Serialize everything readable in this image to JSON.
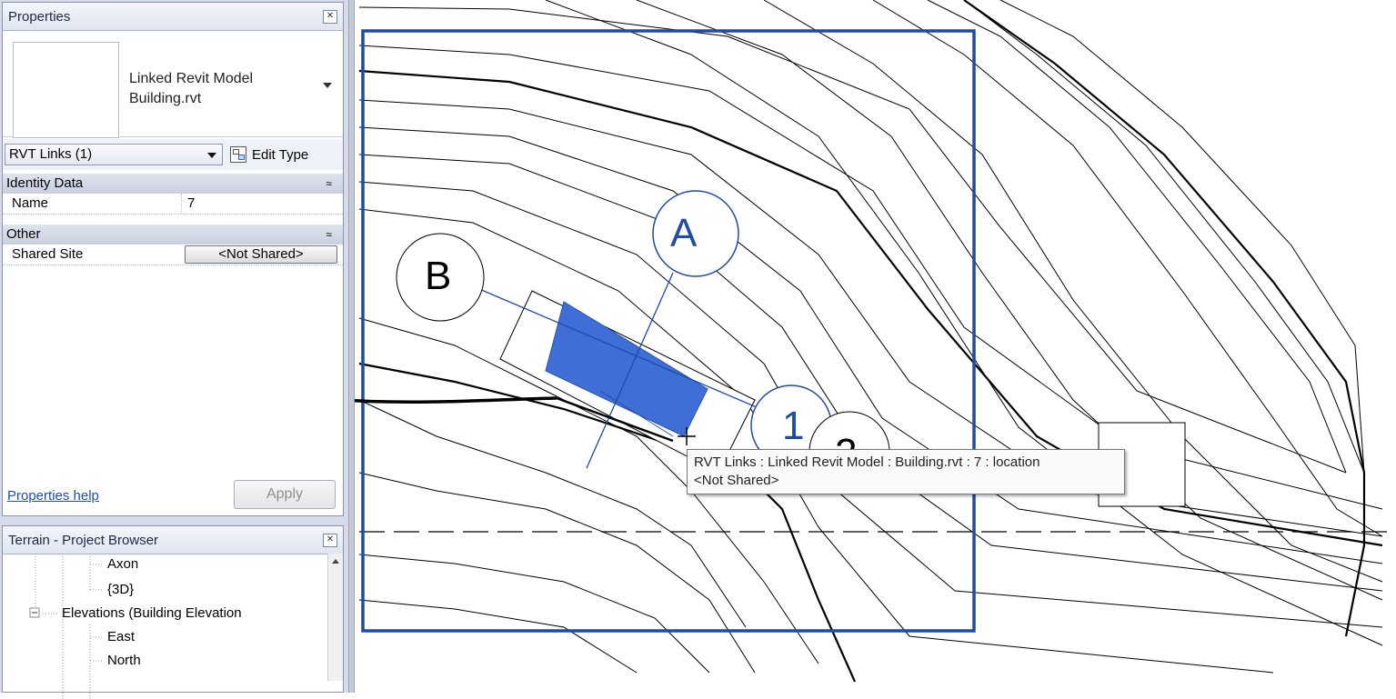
{
  "properties": {
    "title": "Properties",
    "type_name_line1": "Linked Revit Model",
    "type_name_line2": "Building.rvt",
    "filter": "RVT Links (1)",
    "edit_type": "Edit Type",
    "groups": [
      {
        "label": "Identity Data",
        "rows": [
          {
            "label": "Name",
            "value": "7"
          }
        ]
      },
      {
        "label": "Other",
        "rows": [
          {
            "label": "Shared Site",
            "value": "<Not Shared>"
          }
        ]
      }
    ],
    "help_link": "Properties help",
    "apply_button": "Apply"
  },
  "project_browser": {
    "title": "Terrain - Project Browser",
    "items": [
      "Axon",
      "{3D}",
      "Elevations (Building Elevation",
      "East",
      "North"
    ],
    "expander": "⊟"
  },
  "canvas": {
    "grid_labels": [
      "A",
      "B",
      "1",
      "2"
    ],
    "tooltip_line1": "RVT Links : Linked Revit Model : Building.rvt : 7 : location",
    "tooltip_line2": "<Not Shared>"
  },
  "colors": {
    "selection_blue": "#1f4aa8",
    "building_fill": "#3f6fd6",
    "panel_bg": "#d6dbe9"
  }
}
